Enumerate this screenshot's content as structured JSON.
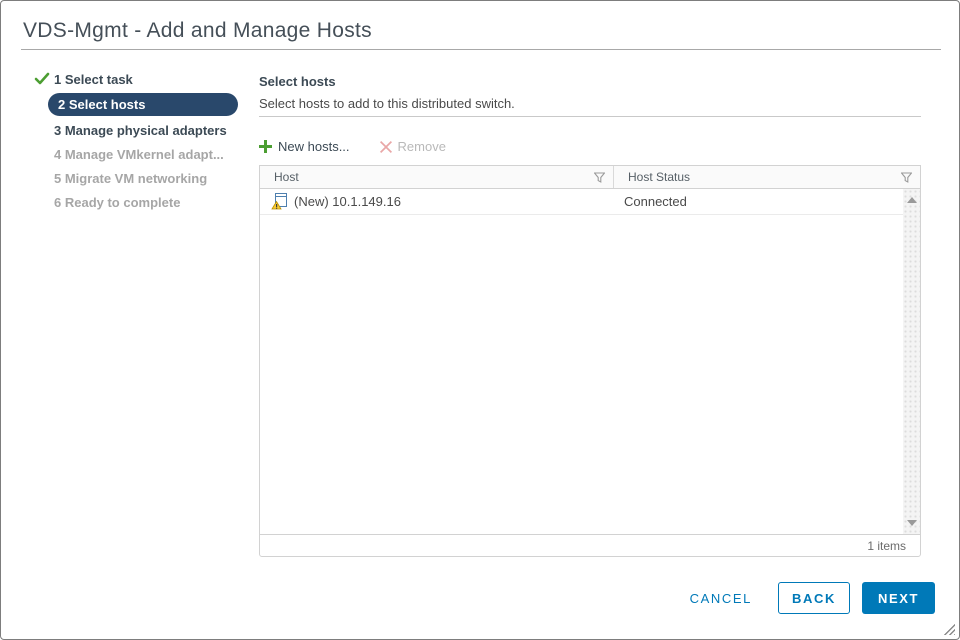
{
  "dialog": {
    "title": "VDS-Mgmt - Add and Manage Hosts"
  },
  "steps": [
    {
      "label": "1 Select task",
      "state": "completed"
    },
    {
      "label": "2 Select hosts",
      "state": "active"
    },
    {
      "label": "3 Manage physical adapters",
      "state": "available"
    },
    {
      "label": "4 Manage VMkernel adapt...",
      "state": "disabled"
    },
    {
      "label": "5 Migrate VM networking",
      "state": "disabled"
    },
    {
      "label": "6 Ready to complete",
      "state": "disabled"
    }
  ],
  "content": {
    "heading": "Select hosts",
    "subheading": "Select hosts to add to this distributed switch.",
    "toolbar": {
      "new_hosts_label": "New hosts...",
      "remove_label": "Remove"
    },
    "table": {
      "columns": [
        "Host",
        "Host Status"
      ],
      "rows": [
        {
          "host": "(New) 10.1.149.16",
          "status": "Connected",
          "icon": "host-warning-icon"
        }
      ],
      "footer_count": "1 items"
    }
  },
  "footer_buttons": {
    "cancel": "CANCEL",
    "back": "BACK",
    "next": "NEXT"
  },
  "colors": {
    "primary_blue": "#0079b8",
    "step_active_bg": "#29486b",
    "success_green": "#4c9e32",
    "disabled_red": "#e9a7a7",
    "warning_yellow": "#f8ca32"
  }
}
